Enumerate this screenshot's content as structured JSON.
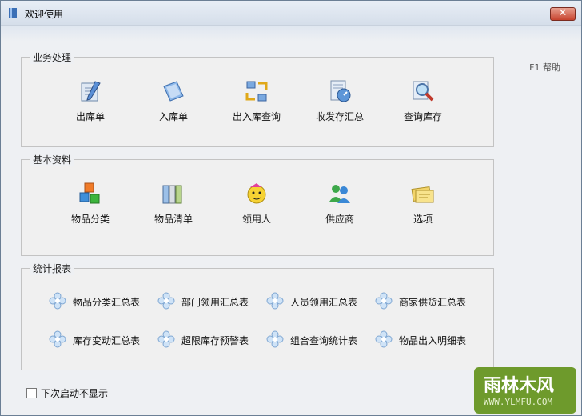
{
  "window": {
    "title": "欢迎使用",
    "close_label": "✕"
  },
  "help": {
    "label": "F1 帮助"
  },
  "business": {
    "title": "业务处理",
    "items": [
      {
        "label": "出库单",
        "icon": "outbound-doc-icon"
      },
      {
        "label": "入库单",
        "icon": "inbound-doc-icon"
      },
      {
        "label": "出入库查询",
        "icon": "transfer-query-icon"
      },
      {
        "label": "收发存汇总",
        "icon": "summary-gauge-icon"
      },
      {
        "label": "查询库存",
        "icon": "inventory-search-icon"
      }
    ]
  },
  "basic": {
    "title": "基本资料",
    "items": [
      {
        "label": "物品分类",
        "icon": "category-cubes-icon"
      },
      {
        "label": "物品清单",
        "icon": "binders-icon"
      },
      {
        "label": "领用人",
        "icon": "person-face-icon"
      },
      {
        "label": "供应商",
        "icon": "users-icon"
      },
      {
        "label": "选项",
        "icon": "notes-icon"
      }
    ]
  },
  "reports": {
    "title": "统计报表",
    "items": [
      {
        "label": "物品分类汇总表"
      },
      {
        "label": "部门领用汇总表"
      },
      {
        "label": "人员领用汇总表"
      },
      {
        "label": "商家供货汇总表"
      },
      {
        "label": "库存变动汇总表"
      },
      {
        "label": "超限库存预警表"
      },
      {
        "label": "组合查询统计表"
      },
      {
        "label": "物品出入明细表"
      }
    ]
  },
  "footer": {
    "dont_show_label": "下次启动不显示",
    "checked": false
  },
  "watermark": {
    "text": "雨林木风",
    "url": "WWW.YLMFU.COM"
  }
}
